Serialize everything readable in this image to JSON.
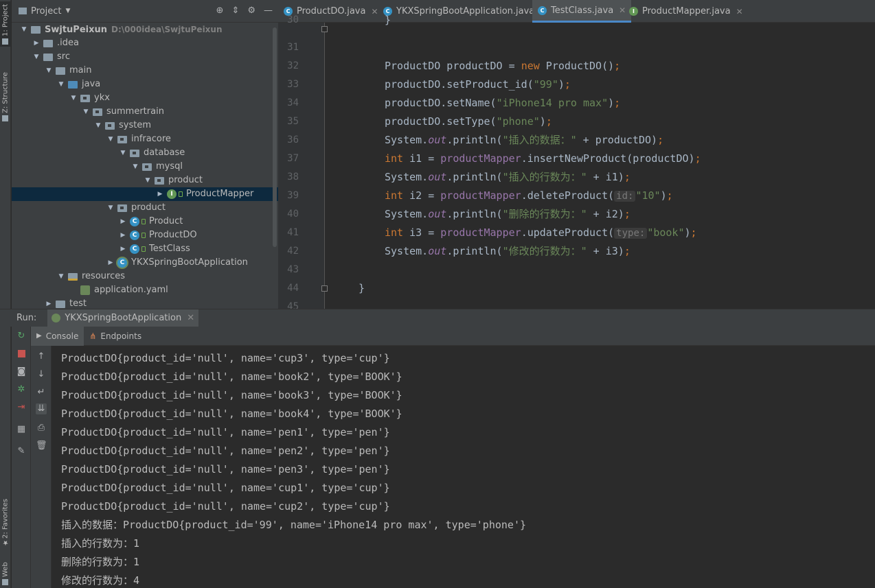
{
  "left_strip": {
    "tab_project": "1: Project",
    "tab_structure": "Z: Structure",
    "tab_favorites": "2: Favorites",
    "tab_web": "Web"
  },
  "project_panel": {
    "title": "Project",
    "tree": [
      {
        "label": "SwjtuPeixun",
        "sub": "D:\\000idea\\SwjtuPeixun",
        "depth": 0,
        "icon": "folder",
        "arrow": "down",
        "bold": true
      },
      {
        "label": ".idea",
        "depth": 1,
        "icon": "folder",
        "arrow": "right"
      },
      {
        "label": "src",
        "depth": 1,
        "icon": "folder",
        "arrow": "down"
      },
      {
        "label": "main",
        "depth": 2,
        "icon": "folder",
        "arrow": "down"
      },
      {
        "label": "java",
        "depth": 3,
        "icon": "folder-blue",
        "arrow": "down"
      },
      {
        "label": "ykx",
        "depth": 4,
        "icon": "package",
        "arrow": "down"
      },
      {
        "label": "summertrain",
        "depth": 5,
        "icon": "package",
        "arrow": "down"
      },
      {
        "label": "system",
        "depth": 6,
        "icon": "package",
        "arrow": "down"
      },
      {
        "label": "infracore",
        "depth": 7,
        "icon": "package",
        "arrow": "down"
      },
      {
        "label": "database",
        "depth": 8,
        "icon": "package",
        "arrow": "down"
      },
      {
        "label": "mysql",
        "depth": 9,
        "icon": "package",
        "arrow": "down"
      },
      {
        "label": "product",
        "depth": 10,
        "icon": "package",
        "arrow": "down"
      },
      {
        "label": "ProductMapper",
        "depth": 11,
        "icon": "interface",
        "arrow": "right",
        "selected": true
      },
      {
        "label": "product",
        "depth": 7,
        "icon": "package",
        "arrow": "down"
      },
      {
        "label": "Product",
        "depth": 8,
        "icon": "class",
        "arrow": "right"
      },
      {
        "label": "ProductDO",
        "depth": 8,
        "icon": "class",
        "arrow": "right"
      },
      {
        "label": "TestClass",
        "depth": 8,
        "icon": "class",
        "arrow": "right"
      },
      {
        "label": "YKXSpringBootApplication",
        "depth": 7,
        "icon": "spring",
        "arrow": "right"
      },
      {
        "label": "resources",
        "depth": 3,
        "icon": "resources",
        "arrow": "down"
      },
      {
        "label": "application.yaml",
        "depth": 4,
        "icon": "yaml",
        "arrow": "none"
      },
      {
        "label": "test",
        "depth": 2,
        "icon": "folder",
        "arrow": "right"
      }
    ]
  },
  "editor_tabs": [
    {
      "label": "ProductDO.java",
      "kind": "C",
      "active": false
    },
    {
      "label": "YKXSpringBootApplication.java",
      "kind": "C",
      "active": false
    },
    {
      "label": "TestClass.java",
      "kind": "C",
      "active": true
    },
    {
      "label": "ProductMapper.java",
      "kind": "I",
      "active": false
    }
  ],
  "code_lines": [
    {
      "num": "30",
      "fold": true,
      "tokens": [
        {
          "t": "}",
          "c": ""
        }
      ]
    },
    {
      "num": "31",
      "tokens": []
    },
    {
      "num": "32",
      "tokens": [
        {
          "t": "ProductDO productDO = ",
          "c": ""
        },
        {
          "t": "new",
          "c": "kw"
        },
        {
          "t": " ProductDO()",
          "c": ""
        },
        {
          "t": ";",
          "c": "kw"
        }
      ]
    },
    {
      "num": "33",
      "tokens": [
        {
          "t": "productDO.setProduct_id(",
          "c": ""
        },
        {
          "t": "\"99\"",
          "c": "st"
        },
        {
          "t": ")",
          "c": ""
        },
        {
          "t": ";",
          "c": "kw"
        }
      ]
    },
    {
      "num": "34",
      "tokens": [
        {
          "t": "productDO.setName(",
          "c": ""
        },
        {
          "t": "\"iPhone14 pro max\"",
          "c": "st"
        },
        {
          "t": ")",
          "c": ""
        },
        {
          "t": ";",
          "c": "kw"
        }
      ]
    },
    {
      "num": "35",
      "tokens": [
        {
          "t": "productDO.setType(",
          "c": ""
        },
        {
          "t": "\"phone\"",
          "c": "st"
        },
        {
          "t": ")",
          "c": ""
        },
        {
          "t": ";",
          "c": "kw"
        }
      ]
    },
    {
      "num": "36",
      "tokens": [
        {
          "t": "System.",
          "c": ""
        },
        {
          "t": "out",
          "c": "it"
        },
        {
          "t": ".println(",
          "c": ""
        },
        {
          "t": "\"插入的数据：\"",
          "c": "st"
        },
        {
          "t": " + productDO)",
          "c": ""
        },
        {
          "t": ";",
          "c": "kw"
        }
      ]
    },
    {
      "num": "37",
      "tokens": [
        {
          "t": "int",
          "c": "kw"
        },
        {
          "t": " i1 = ",
          "c": ""
        },
        {
          "t": "productMapper",
          "c": "fl"
        },
        {
          "t": ".insertNewProduct(productDO)",
          "c": ""
        },
        {
          "t": ";",
          "c": "kw"
        }
      ]
    },
    {
      "num": "38",
      "tokens": [
        {
          "t": "System.",
          "c": ""
        },
        {
          "t": "out",
          "c": "it"
        },
        {
          "t": ".println(",
          "c": ""
        },
        {
          "t": "\"插入的行数为：\"",
          "c": "st"
        },
        {
          "t": " + i1)",
          "c": ""
        },
        {
          "t": ";",
          "c": "kw"
        }
      ]
    },
    {
      "num": "39",
      "tokens": [
        {
          "t": "int",
          "c": "kw"
        },
        {
          "t": " i2 = ",
          "c": ""
        },
        {
          "t": "productMapper",
          "c": "fl"
        },
        {
          "t": ".deleteProduct(",
          "c": ""
        },
        {
          "t": "id:",
          "c": "hint"
        },
        {
          "t": "\"10\"",
          "c": "st"
        },
        {
          "t": ")",
          "c": ""
        },
        {
          "t": ";",
          "c": "kw"
        }
      ]
    },
    {
      "num": "40",
      "tokens": [
        {
          "t": "System.",
          "c": ""
        },
        {
          "t": "out",
          "c": "it"
        },
        {
          "t": ".println(",
          "c": ""
        },
        {
          "t": "\"删除的行数为：\"",
          "c": "st"
        },
        {
          "t": " + i2)",
          "c": ""
        },
        {
          "t": ";",
          "c": "kw"
        }
      ]
    },
    {
      "num": "41",
      "tokens": [
        {
          "t": "int",
          "c": "kw"
        },
        {
          "t": " i3 = ",
          "c": ""
        },
        {
          "t": "productMapper",
          "c": "fl"
        },
        {
          "t": ".updateProduct(",
          "c": ""
        },
        {
          "t": "type:",
          "c": "hint"
        },
        {
          "t": "\"book\"",
          "c": "st"
        },
        {
          "t": ")",
          "c": ""
        },
        {
          "t": ";",
          "c": "kw"
        }
      ]
    },
    {
      "num": "42",
      "tokens": [
        {
          "t": "System.",
          "c": ""
        },
        {
          "t": "out",
          "c": "it"
        },
        {
          "t": ".println(",
          "c": ""
        },
        {
          "t": "\"修改的行数为：\"",
          "c": "st"
        },
        {
          "t": " + i3)",
          "c": ""
        },
        {
          "t": ";",
          "c": "kw"
        }
      ]
    },
    {
      "num": "43",
      "tokens": []
    },
    {
      "num": "44",
      "fold": true,
      "indent": "outer",
      "tokens": [
        {
          "t": "}",
          "c": ""
        }
      ]
    },
    {
      "num": "45",
      "tokens": []
    }
  ],
  "run_bar": {
    "label": "Run:",
    "config": "YKXSpringBootApplication"
  },
  "console_tabs": {
    "console": "Console",
    "endpoints": "Endpoints"
  },
  "console_lines": [
    "ProductDO{product_id='null', name='cup3', type='cup'}",
    "ProductDO{product_id='null', name='book2', type='BOOK'}",
    "ProductDO{product_id='null', name='book3', type='BOOK'}",
    "ProductDO{product_id='null', name='book4', type='BOOK'}",
    "ProductDO{product_id='null', name='pen1', type='pen'}",
    "ProductDO{product_id='null', name='pen2', type='pen'}",
    "ProductDO{product_id='null', name='pen3', type='pen'}",
    "ProductDO{product_id='null', name='cup1', type='cup'}",
    "ProductDO{product_id='null', name='cup2', type='cup'}",
    "插入的数据：ProductDO{product_id='99', name='iPhone14 pro max', type='phone'}",
    "插入的行数为：1",
    "删除的行数为：1",
    "修改的行数为：4"
  ],
  "colors": {
    "keyword": "#cc7832",
    "string": "#6a8759",
    "field": "#9876aa",
    "text": "#a9b7c6",
    "bg": "#2b2b2b",
    "panel": "#3c3f41",
    "selection": "#0d293e",
    "accent": "#4a88c7"
  }
}
